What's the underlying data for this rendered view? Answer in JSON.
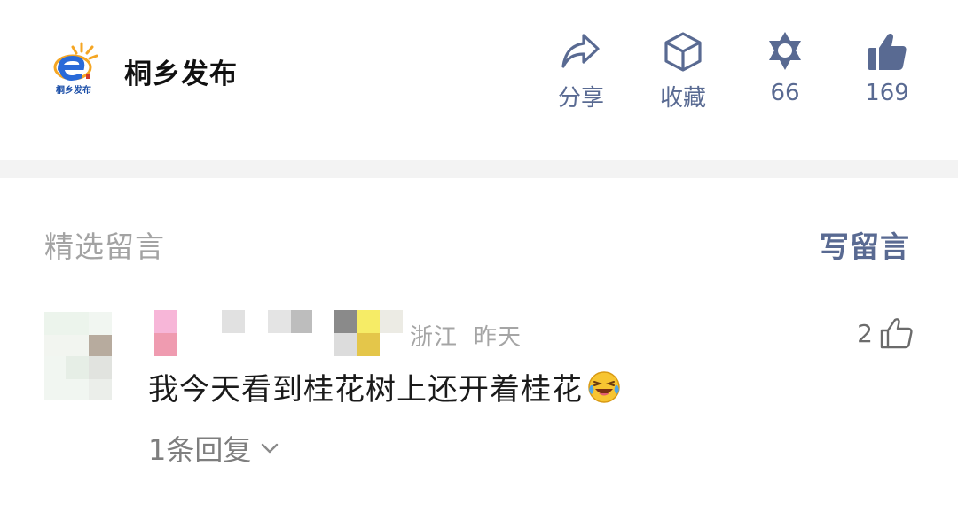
{
  "header": {
    "account_name": "桐乡发布",
    "logo_text": "桐乡发布",
    "actions": [
      {
        "icon": "share-icon",
        "label": "分享"
      },
      {
        "icon": "collect-icon",
        "label": "收藏"
      },
      {
        "icon": "wow-icon",
        "label": "66"
      },
      {
        "icon": "thumbs-up-icon",
        "label": "169"
      }
    ]
  },
  "comments_section": {
    "title": "精选留言",
    "write_label": "写留言",
    "comments": [
      {
        "location": "浙江",
        "time": "昨天",
        "likes": "2",
        "text": "我今天看到桂花树上还开着桂花",
        "emoji": "laughing-crying-emoji",
        "replies": "1条回复"
      }
    ]
  },
  "colors": {
    "link": "#596a92",
    "muted": "#a3a3a3",
    "text": "#1a1a1a",
    "divider": "#f3f3f3"
  }
}
